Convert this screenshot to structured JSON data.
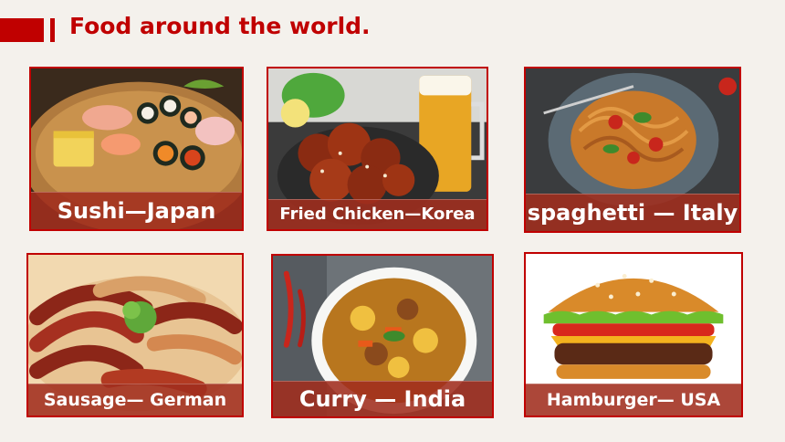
{
  "slide": {
    "title": "Food around the world.",
    "accent_color": "#c00000",
    "label_bg": "#a02d1e"
  },
  "cards": [
    {
      "label": "Sushi—Japan",
      "image": "sushi-platter"
    },
    {
      "label": "Fried Chicken—Korea",
      "image": "fried-chicken-and-beer"
    },
    {
      "label": "spaghetti — Italy",
      "image": "spaghetti-plate"
    },
    {
      "label": "Sausage— German",
      "image": "sausage-platter"
    },
    {
      "label": "Curry — India",
      "image": "curry-bowl"
    },
    {
      "label": "Hamburger— USA",
      "image": "hamburger"
    }
  ]
}
